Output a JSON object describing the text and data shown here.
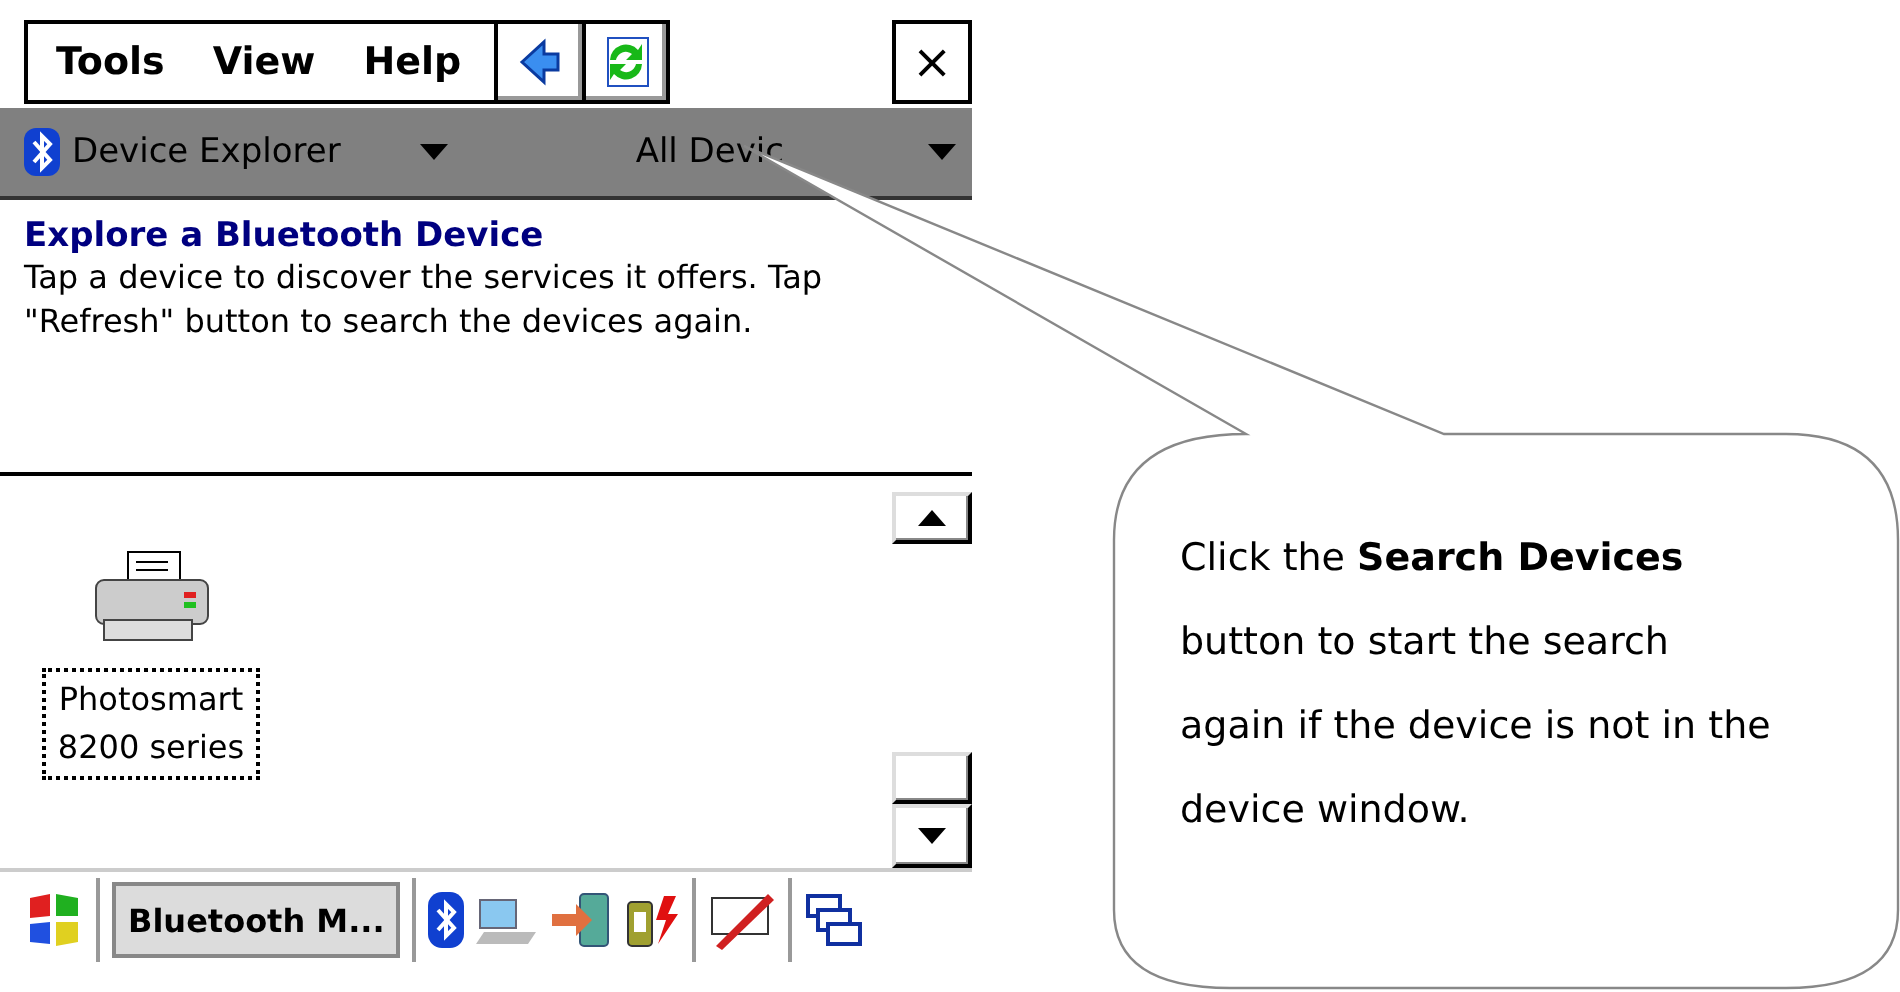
{
  "menu": [
    {
      "label": "Tools"
    },
    {
      "label": "View"
    },
    {
      "label": "Help"
    }
  ],
  "close_button": "×",
  "nav_bar": {
    "app": "Device Explorer",
    "filter": "All Devic"
  },
  "info": {
    "title": "Explore a Bluetooth Device",
    "text": "Tap a device to discover the services it offers. Tap \"Refresh\" button to search the devices again."
  },
  "devices": [
    {
      "name": "Photosmart 8200 series",
      "selected": true
    }
  ],
  "taskbar": {
    "task": "Bluetooth M..."
  },
  "callout": {
    "text": "Click the **Search Devices** button to start the search again if the device is not in the device window."
  }
}
